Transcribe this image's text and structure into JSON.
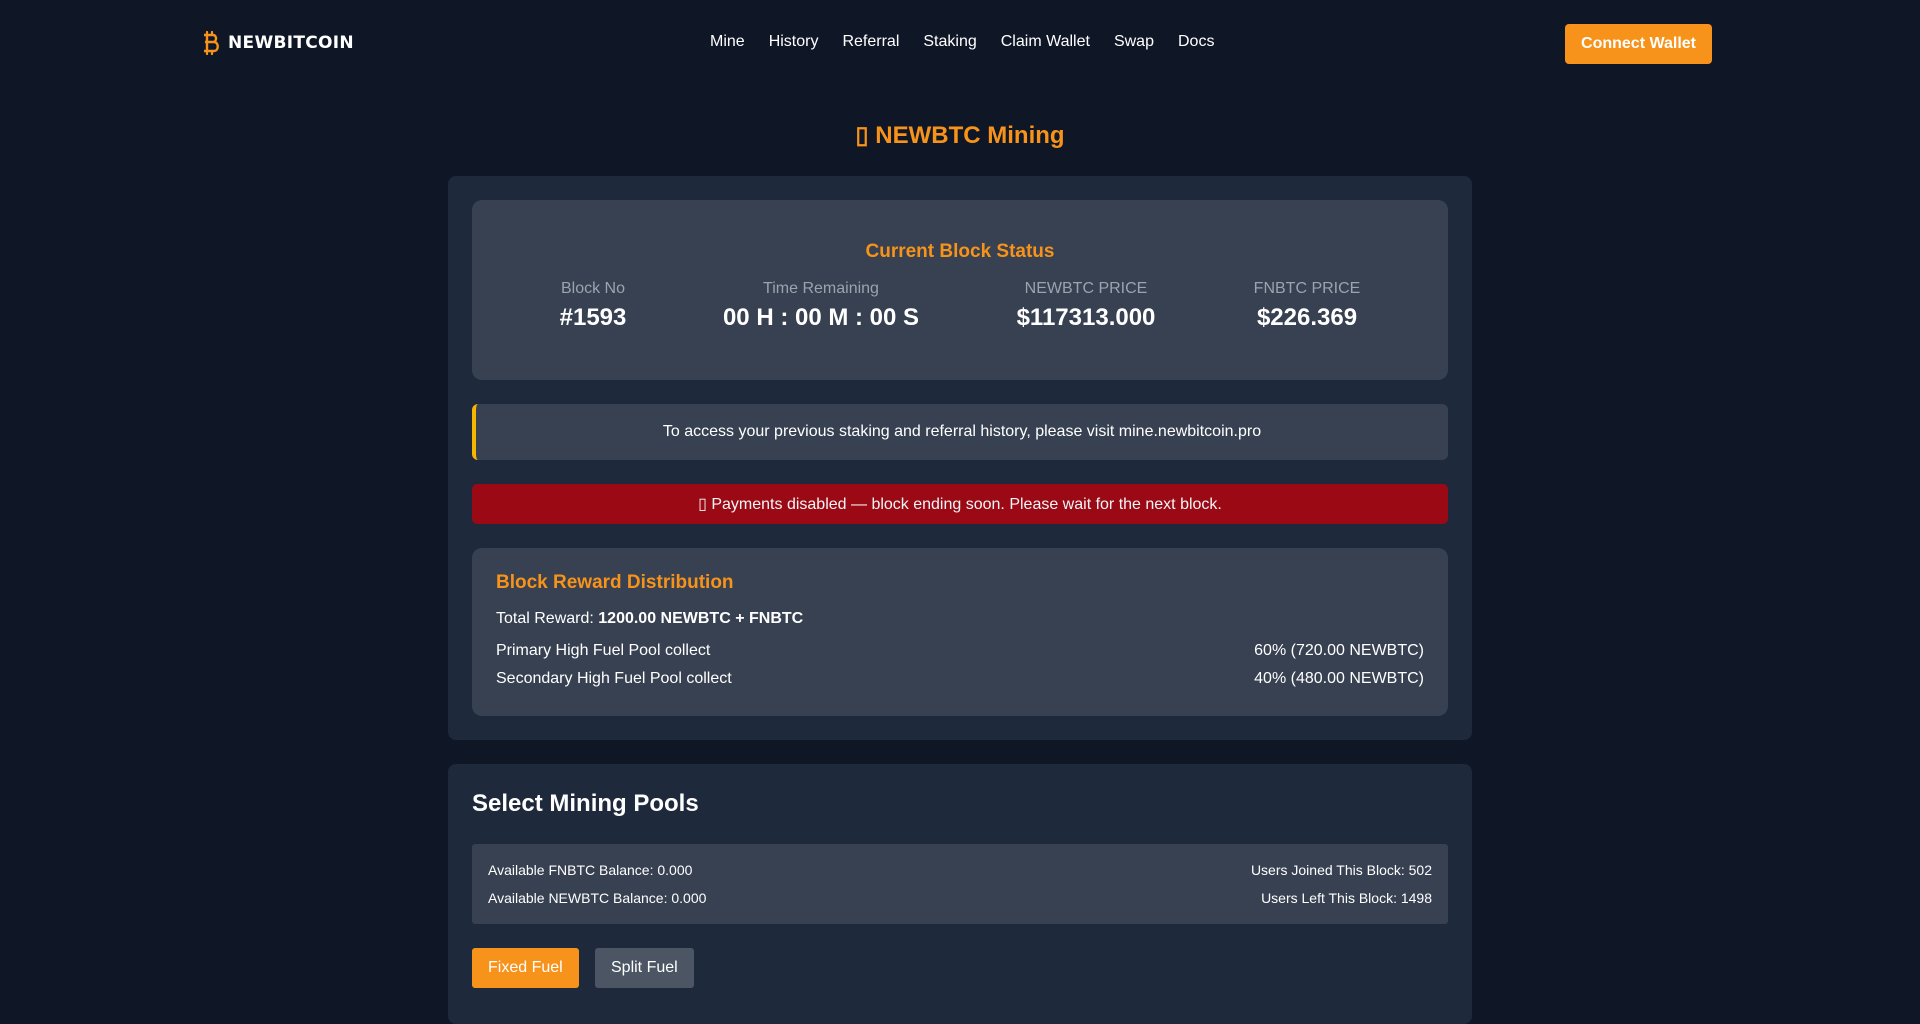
{
  "brand": {
    "name": "NEWBITCOIN",
    "accent": "#f7931a"
  },
  "nav": {
    "items": [
      {
        "label": "Mine"
      },
      {
        "label": "History"
      },
      {
        "label": "Referral"
      },
      {
        "label": "Staking"
      },
      {
        "label": "Claim Wallet"
      },
      {
        "label": "Swap"
      },
      {
        "label": "Docs"
      }
    ],
    "connect_label": "Connect Wallet"
  },
  "page": {
    "title": "▯ NEWBTC Mining"
  },
  "block_status": {
    "title": "Current Block Status",
    "block_no_label": "Block No",
    "block_no": "#1593",
    "time_label": "Time Remaining",
    "time_value": "00 H : 00 M : 00 S",
    "newbtc_price_label": "NEWBTC PRICE",
    "newbtc_price": "$117313.000",
    "fnbtc_price_label": "FNBTC PRICE",
    "fnbtc_price": "$226.369"
  },
  "notice": {
    "text": "To access your previous staking and referral history, please visit mine.newbitcoin.pro"
  },
  "alert": {
    "text": "▯ Payments disabled — block ending soon. Please wait for the next block."
  },
  "reward": {
    "title": "Block Reward Distribution",
    "total_label": "Total Reward: ",
    "total_value": "1200.00 NEWBTC + FNBTC",
    "rows": [
      {
        "label": "Primary High Fuel Pool collect",
        "value": "60% (720.00 NEWBTC)"
      },
      {
        "label": "Secondary High Fuel Pool collect",
        "value": "40% (480.00 NEWBTC)"
      }
    ]
  },
  "pools": {
    "title": "Select Mining Pools",
    "fnbtc_balance": "Available FNBTC Balance: 0.000",
    "newbtc_balance": "Available NEWBTC Balance: 0.000",
    "users_joined": "Users Joined This Block: 502",
    "users_left": "Users Left This Block: 1498",
    "fixed_label": "Fixed Fuel",
    "split_label": "Split Fuel"
  }
}
